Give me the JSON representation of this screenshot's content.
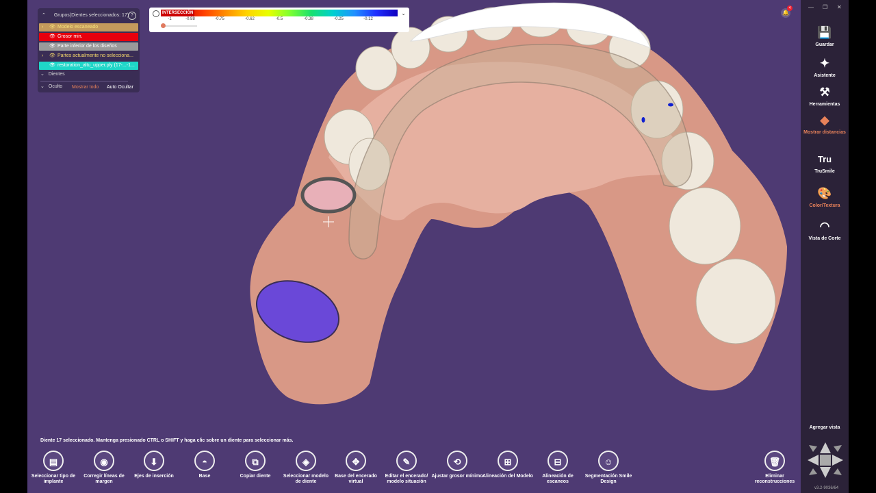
{
  "groups": {
    "title": "Grupos(Dientes seleccionados: 17)",
    "help": "?",
    "items": [
      {
        "label": "Modelo escaneado",
        "bg": "#c49a5c",
        "color": "#f6e27a",
        "arrow": "›"
      },
      {
        "label": "Grosor min.",
        "bg": "#e8000d",
        "color": "#ffffff",
        "arrow": ""
      },
      {
        "label": "Parte inferior de los diseños",
        "bg": "#9a9a9a",
        "color": "#ffffff",
        "arrow": ""
      },
      {
        "label": "Partes actualmente no selecciona...",
        "bg": "#3a2d55",
        "color": "#f6d96b",
        "arrow": "›"
      },
      {
        "label": "restoration_altu_upper.ply (17-...-1...",
        "bg": "#1fd6c8",
        "color": "#ffffff",
        "arrow": ""
      }
    ],
    "sections": [
      "Dientes",
      "Oculto"
    ],
    "show_all": "Mostrar todo",
    "auto_hide": "Auto Ocultar"
  },
  "scale": {
    "label": "INTERSECCIÓN",
    "ticks": [
      "-1",
      "-0.88",
      "-0.75",
      "-0.62",
      "-0.5",
      "-0.38",
      "-0.25",
      "-0.12"
    ],
    "value": -1
  },
  "notifications": {
    "count": "4"
  },
  "right_toolbar": [
    {
      "label": "Guardar",
      "icon": "save-icon",
      "glyph": "💾",
      "active": false
    },
    {
      "label": "Asistente",
      "icon": "magic-wand-icon",
      "glyph": "✦",
      "active": false
    },
    {
      "label": "Herramientas",
      "icon": "tools-icon",
      "glyph": "⚒",
      "active": false
    },
    {
      "label": "Mostrar distancias",
      "icon": "distance-icon",
      "glyph": "◆",
      "active": true
    },
    {
      "label": "TruSmile",
      "icon": "trusmile-icon",
      "glyph": "Tru",
      "active": false
    },
    {
      "label": "Color/Textura",
      "icon": "palette-icon",
      "glyph": "🎨",
      "active": true
    },
    {
      "label": "Vista de Corte",
      "icon": "tooth-cut-icon",
      "glyph": "◠",
      "active": false
    }
  ],
  "add_view": "Agregar vista",
  "version": "v3.2-9036/64",
  "status": "Diente 17 seleccionado. Mantenga presionado CTRL o SHIFT y haga clic sobre un diente para seleccionar más.",
  "bottom_toolbar": [
    {
      "label": "Seleccionar tipo de implante",
      "icon": "select-type-icon",
      "glyph": "▤"
    },
    {
      "label": "Corregir líneas de margen",
      "icon": "margin-line-icon",
      "glyph": "◉"
    },
    {
      "label": "Ejes de inserción",
      "icon": "insertion-axis-icon",
      "glyph": "⬇"
    },
    {
      "label": "Base",
      "icon": "base-icon",
      "glyph": "◓"
    },
    {
      "label": "Copiar diente",
      "icon": "copy-tooth-icon",
      "glyph": "⧉"
    },
    {
      "label": "Seleccionar modelo de diente",
      "icon": "tooth-model-icon",
      "glyph": "◈"
    },
    {
      "label": "Base del encerado virtual",
      "icon": "wax-base-icon",
      "glyph": "✥"
    },
    {
      "label": "Editar el encerado/ modelo situación",
      "icon": "edit-wax-icon",
      "glyph": "✎"
    },
    {
      "label": "Ajustar grosor mínimo",
      "icon": "thickness-icon",
      "glyph": "⟲"
    },
    {
      "label": "Alineación del Modelo",
      "icon": "model-align-icon",
      "glyph": "⊞"
    },
    {
      "label": "Alineación de escaneos",
      "icon": "scan-align-icon",
      "glyph": "⊟"
    },
    {
      "label": "Segmentación Smile Design",
      "icon": "smile-design-icon",
      "glyph": "☺"
    },
    {
      "label": "Eliminar reconstrucciones",
      "icon": "trash-icon",
      "glyph": "🗑"
    }
  ]
}
